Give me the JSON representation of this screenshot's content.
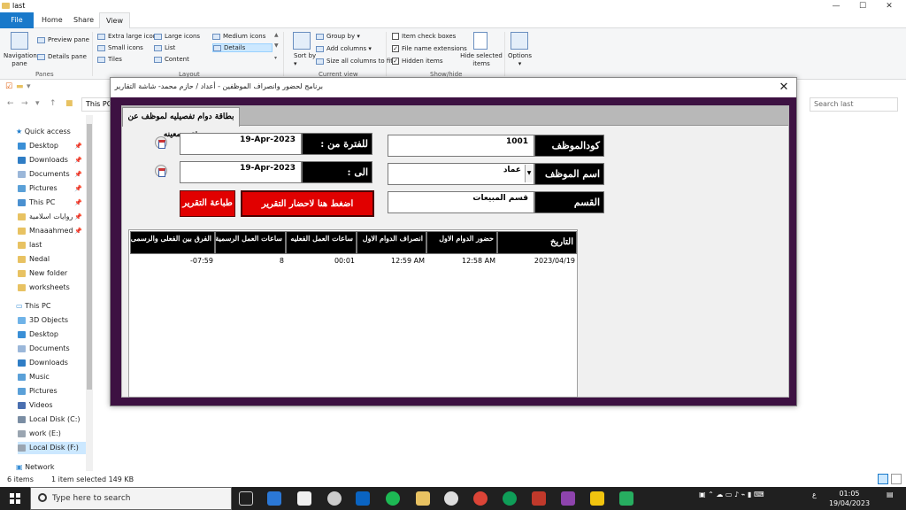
{
  "explorer": {
    "title": "last",
    "tabs": {
      "file": "File",
      "home": "Home",
      "share": "Share",
      "view": "View"
    },
    "ribbon": {
      "panes": {
        "navigation_pane": "Navigation pane",
        "preview_pane": "Preview pane",
        "details_pane": "Details pane",
        "group_label": "Panes"
      },
      "layout": {
        "extra_large": "Extra large icons",
        "large": "Large icons",
        "medium": "Medium icons",
        "small": "Small icons",
        "list": "List",
        "details": "Details",
        "tiles": "Tiles",
        "content": "Content",
        "group_label": "Layout"
      },
      "current_view": {
        "sort_by": "Sort by",
        "group_by": "Group by",
        "add_columns": "Add columns",
        "size_all": "Size all columns to fit",
        "group_label": "Current view"
      },
      "show_hide": {
        "item_check_boxes": "Item check boxes",
        "file_name_extensions": "File name extensions",
        "hidden_items": "Hidden items",
        "hide_selected": "Hide selected items",
        "group_label": "Show/hide"
      },
      "options": "Options"
    },
    "address": "This PC",
    "search_placeholder": "Search last",
    "nav": {
      "quick_access": "Quick access",
      "items": [
        "Desktop",
        "Downloads",
        "Documents",
        "Pictures",
        "This PC",
        "روايات اسلامية",
        "Mnaaahmed",
        "last",
        "Nedal",
        "New folder",
        "worksheets"
      ],
      "this_pc": "This PC",
      "pc_items": [
        "3D Objects",
        "Desktop",
        "Documents",
        "Downloads",
        "Music",
        "Pictures",
        "Videos",
        "Local Disk (C:)",
        "work (E:)",
        "Local Disk (F:)"
      ],
      "network": "Network"
    },
    "status": {
      "items": "6 items",
      "selected": "1 item selected  149 KB"
    }
  },
  "taskbar": {
    "search": "Type here to search",
    "lang": "ع",
    "time": "01:05",
    "date": "19/04/2023"
  },
  "dialog": {
    "title": "برنامج لحضور وانصراف الموظفين - أعداد / حازم محمد- شاشة التقارير",
    "tab": "بطاقة دوام تفصيليه لموظف عن فتره معينه",
    "labels": {
      "emp_code": "كودالموظف",
      "emp_name": "اسم الموظف",
      "department": "القسم",
      "from": "للفترة من :",
      "to": "الى :"
    },
    "values": {
      "emp_code": "1001",
      "emp_name": "عماد",
      "department": "قسم المبيعات",
      "from": "19-Apr-2023",
      "to": "19-Apr-2023"
    },
    "buttons": {
      "show_report": "اضغط هنا لاحضار التقرير",
      "print_report": "طباعة التقرير"
    },
    "grid": {
      "headers": [
        "التاريخ",
        "حضور الدوام الاول",
        "انصراف الدوام الاول",
        "ساعات العمل الفعليه",
        "ساعات العمل الرسمية",
        "الفرق بين الفعلى والرسمى"
      ],
      "rows": [
        [
          "2023/04/19",
          "12:58 AM",
          "12:59 AM",
          "00:01",
          "8",
          "-07:59"
        ]
      ]
    }
  }
}
